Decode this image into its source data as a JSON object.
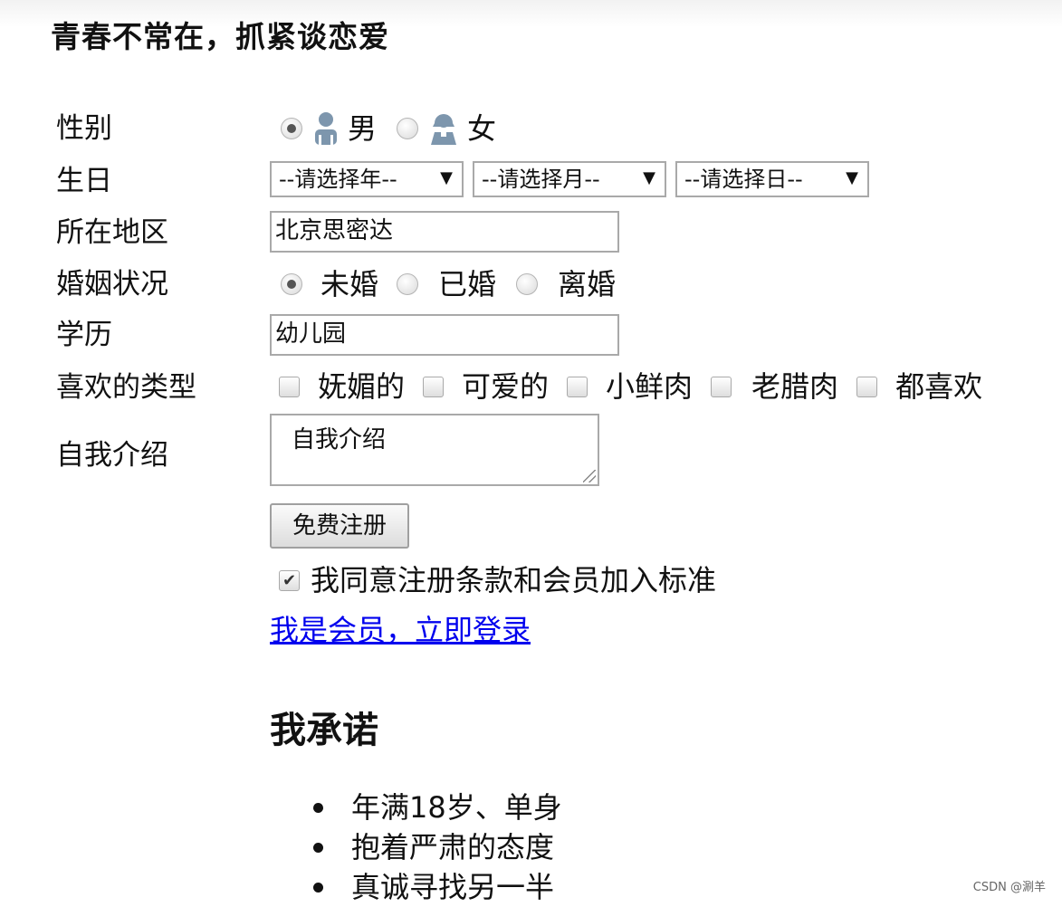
{
  "page": {
    "title": "青春不常在，抓紧谈恋爱"
  },
  "form": {
    "gender": {
      "label": "性别",
      "options": [
        "男",
        "女"
      ],
      "selected": "男"
    },
    "birthday": {
      "label": "生日",
      "year": "--请选择年--",
      "month": "--请选择月--",
      "day": "--请选择日--"
    },
    "region": {
      "label": "所在地区",
      "value": "北京思密达"
    },
    "marital": {
      "label": "婚姻状况",
      "options": [
        "未婚",
        "已婚",
        "离婚"
      ],
      "selected": "未婚"
    },
    "education": {
      "label": "学历",
      "value": "幼儿园"
    },
    "types": {
      "label": "喜欢的类型",
      "options": [
        "妩媚的",
        "可爱的",
        "小鲜肉",
        "老腊肉",
        "都喜欢"
      ]
    },
    "intro": {
      "label": "自我介绍",
      "value": "自我介绍"
    },
    "submit_label": "免费注册",
    "agree": {
      "label": "我同意注册条款和会员加入标准",
      "checked": true
    },
    "login_link": "我是会员，立即登录"
  },
  "promise": {
    "title": "我承诺",
    "items": [
      "年满18岁、单身",
      "抱着严肃的态度",
      "真诚寻找另一半"
    ]
  },
  "watermark": "CSDN @涮羊",
  "icons": {
    "male": "male-user-icon",
    "female": "female-user-icon",
    "dropdown": "dropdown-arrow-icon"
  }
}
